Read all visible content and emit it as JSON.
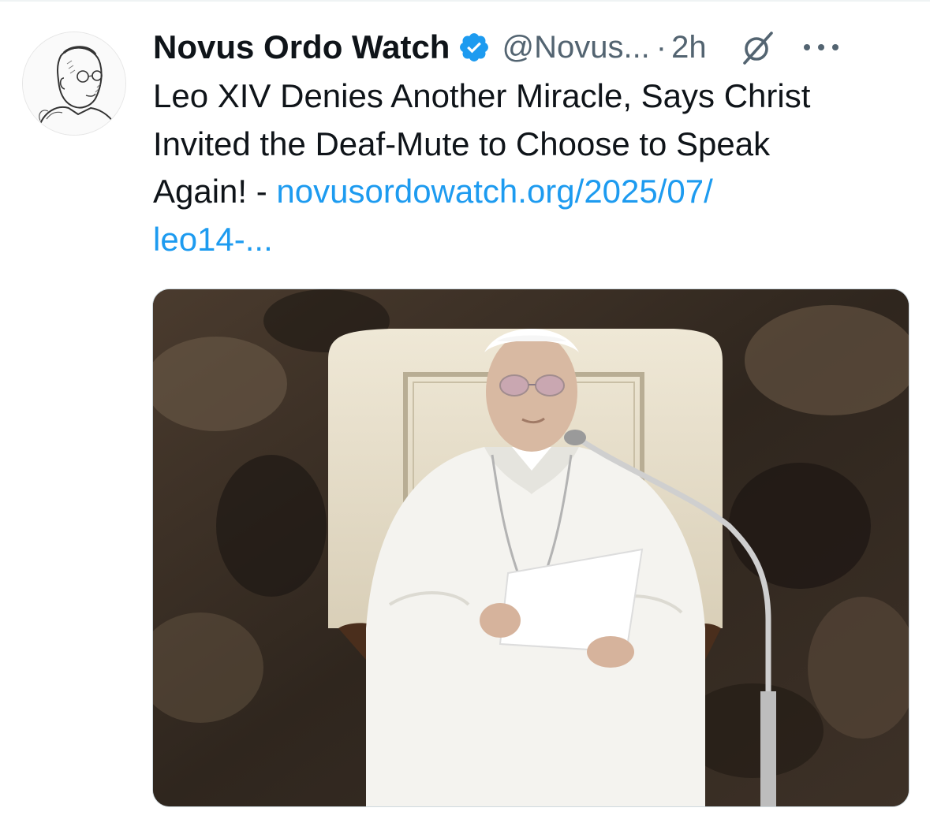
{
  "tweet": {
    "display_name": "Novus Ordo Watch",
    "handle": "@Novus...",
    "separator": "·",
    "time": "2h",
    "text_lines": [
      "Leo XIV Denies Another Miracle, Says Christ",
      "Invited the Deaf-Mute to Choose to Speak",
      "Again! - "
    ],
    "link_part1": "novusordowatch.org/2025/07/",
    "link_part2": "leo14-...",
    "verified_icon": "verified-badge-icon",
    "grok_icon": "grok-icon",
    "more_icon": "more-options-icon",
    "avatar_icon": "avatar-portrait",
    "media_alt": "photo"
  },
  "colors": {
    "text": "#0f1419",
    "secondary": "#536471",
    "link": "#1d9bf0",
    "verified": "#1d9bf0"
  }
}
